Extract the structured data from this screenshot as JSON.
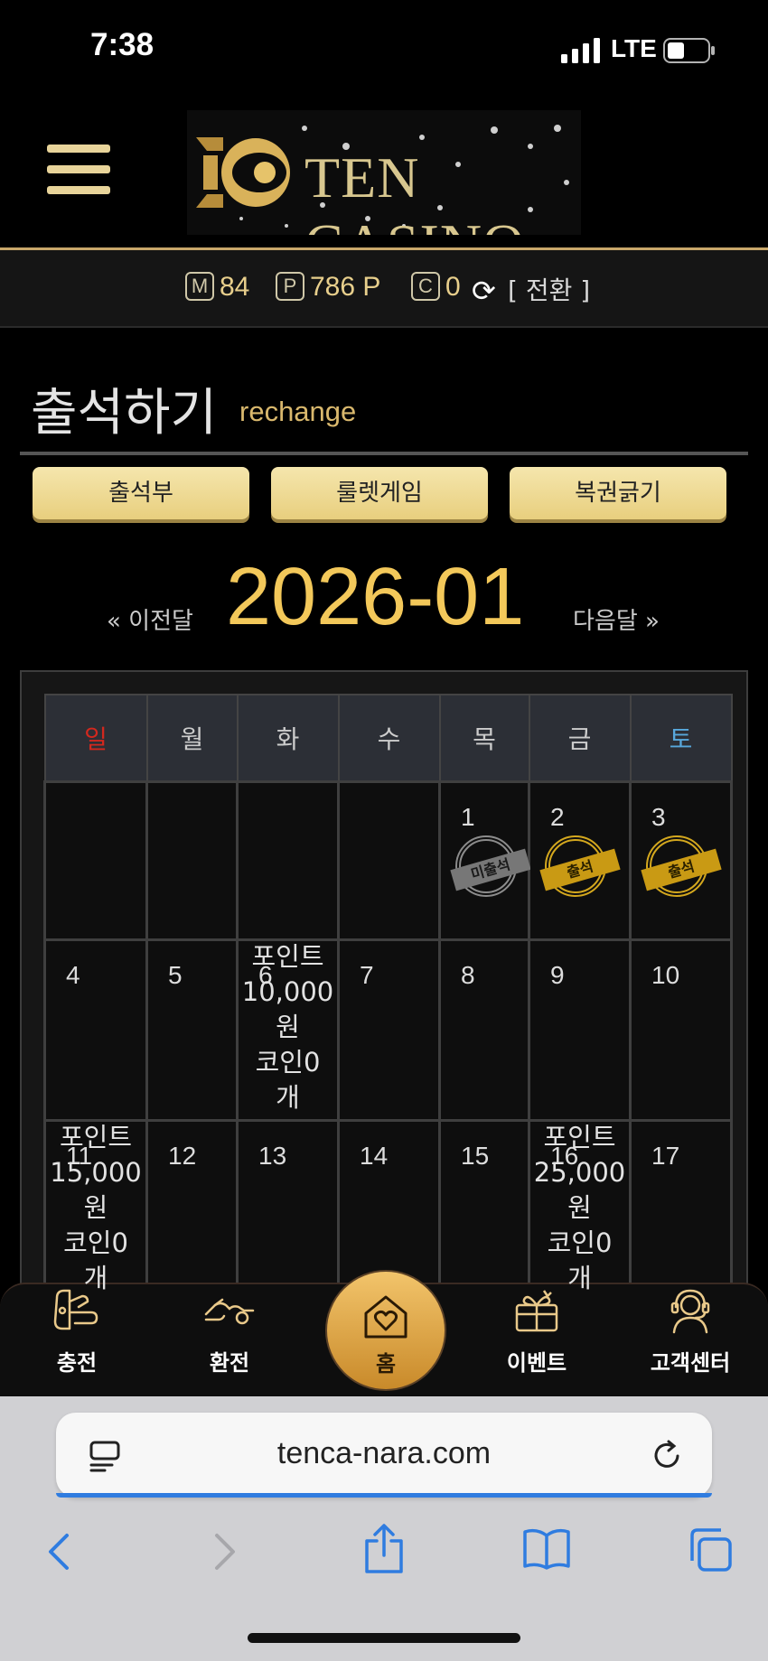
{
  "status": {
    "time": "7:38",
    "network": "LTE"
  },
  "header": {
    "logo_text": "TEN CASINO"
  },
  "balance": {
    "money_icon": "M",
    "money": "84",
    "point_icon": "P",
    "point": "786 P",
    "coin_icon": "C",
    "coin": "0",
    "switch_label": "[ 전환 ]"
  },
  "page": {
    "title": "출석하기",
    "subtitle": "rechange"
  },
  "tabs": [
    "출석부",
    "룰렛게임",
    "복권긁기"
  ],
  "month_nav": {
    "prev": "« 이전달",
    "current": "2026-01",
    "next": "다음달 »"
  },
  "calendar": {
    "weekdays": [
      "일",
      "월",
      "화",
      "수",
      "목",
      "금",
      "토"
    ],
    "weekday_colors": {
      "sun": "#d2281e",
      "sat": "#58a8dc",
      "other": "#cccccc"
    },
    "stamps": {
      "absent": "미출석",
      "present": "출석"
    },
    "week1": [
      "",
      "",
      "",
      "",
      "1",
      "2",
      "3"
    ],
    "week2": [
      "4",
      "5",
      "6",
      "7",
      "8",
      "9",
      "10"
    ],
    "week3": [
      "11",
      "12",
      "13",
      "14",
      "15",
      "16",
      "17"
    ],
    "notes": {
      "day6": [
        "포인트",
        "10,000",
        "원",
        "코인0",
        "개"
      ],
      "day11": [
        "포인트",
        "15,000",
        "원",
        "코인0",
        "개"
      ],
      "day16": [
        "포인트",
        "25,000",
        "원",
        "코인0",
        "개"
      ]
    }
  },
  "bottom_nav": {
    "charge": "충전",
    "exchange": "환전",
    "home": "홈",
    "event": "이벤트",
    "support": "고객센터"
  },
  "browser": {
    "url": "tenca-nara.com"
  },
  "colors": {
    "accent_gold": "#f3c85a",
    "button_gold": "#f0dc98",
    "link_blue": "#2f7ce0"
  }
}
